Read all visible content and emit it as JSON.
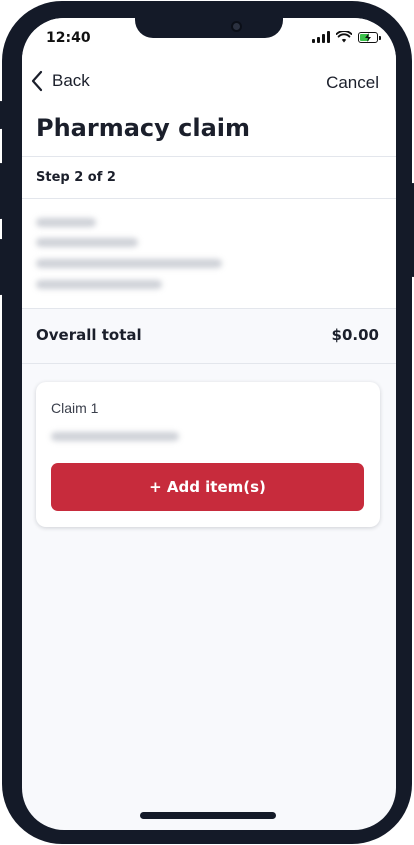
{
  "status_bar": {
    "time": "12:40",
    "icons": [
      "signal-icon",
      "wifi-icon",
      "battery-charging-icon"
    ],
    "battery_level_percent": 60
  },
  "nav": {
    "back_label": "Back",
    "cancel_label": "Cancel"
  },
  "page": {
    "title": "Pharmacy claim",
    "step": "Step 2 of 2"
  },
  "summary": {
    "total_label": "Overall total",
    "total_value": "$0.00"
  },
  "claim": {
    "title": "Claim 1",
    "add_button_label": "+ Add item(s)"
  },
  "colors": {
    "primary_button": "#c72b3c",
    "background": "#f8f9fc",
    "text": "#1b1f2b"
  }
}
